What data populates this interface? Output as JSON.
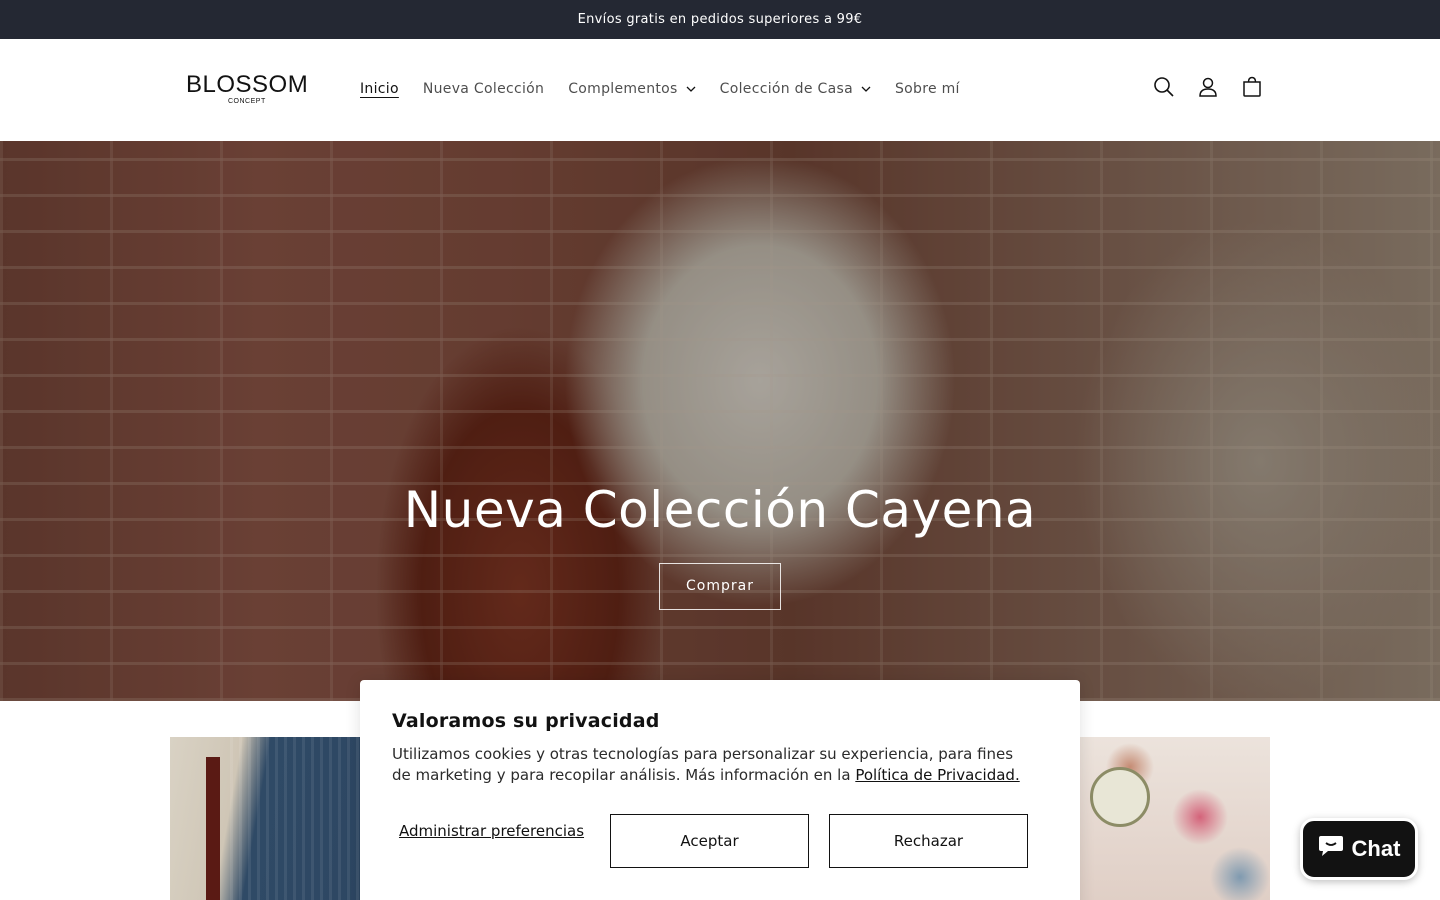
{
  "announcement": {
    "text": "Envíos gratis en pedidos superiores a 99€"
  },
  "header": {
    "logo": {
      "main": "BLOSSOM",
      "sub": "CONCEPT"
    },
    "nav": [
      {
        "label": "Inicio",
        "active": true,
        "dropdown": false
      },
      {
        "label": "Nueva Colección",
        "active": false,
        "dropdown": false
      },
      {
        "label": "Complementos",
        "active": false,
        "dropdown": true
      },
      {
        "label": "Colección de Casa",
        "active": false,
        "dropdown": true
      },
      {
        "label": "Sobre mí",
        "active": false,
        "dropdown": false
      }
    ],
    "icons": [
      "search-icon",
      "account-icon",
      "cart-icon"
    ]
  },
  "hero": {
    "title": "Nueva Colección Cayena",
    "button_label": "Comprar"
  },
  "cookie_banner": {
    "title": "Valoramos su privacidad",
    "text": "Utilizamos cookies y otras tecnologías para personalizar su experiencia, para fines de marketing y para recopilar análisis. Más información en la",
    "link_text": "Política de Privacidad.",
    "manage_label": "Administrar preferencias",
    "accept_label": "Aceptar",
    "reject_label": "Rechazar"
  },
  "chat": {
    "label": "Chat",
    "icon": "chat-bubble-icon"
  },
  "colors": {
    "announcement_bg": "#242833",
    "text": "#121212",
    "chat_bg": "#121212"
  }
}
